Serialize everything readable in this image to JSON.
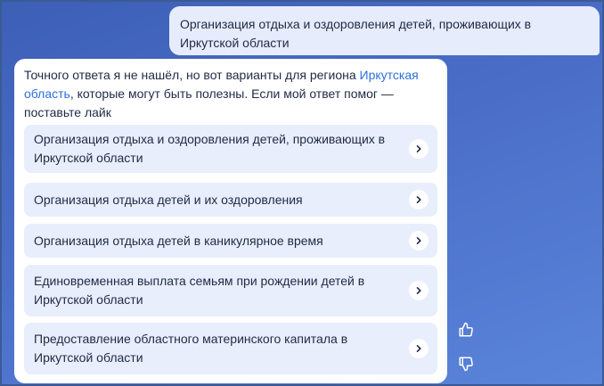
{
  "user_message": "Организация отдыха и оздоровления детей, проживающих в Иркутской области",
  "bot": {
    "text_before_link": "Точного ответа я не нашёл, но вот варианты для региона ",
    "region_link": "Иркутская область",
    "text_after_link": ", которые могут быть полезны. Если мой ответ помог — поставьте лайк",
    "options": [
      {
        "label": "Организация отдыха и оздоровления детей, проживающих в Иркутской области"
      },
      {
        "label": "Организация отдыха детей и их оздоровления"
      },
      {
        "label": "Организация отдыха детей в каникулярное время"
      },
      {
        "label": "Единовременная выплата семьям при рождении детей в Иркутской области"
      },
      {
        "label": "Предоставление областного материнского капитала в Иркутской области"
      }
    ]
  },
  "icons": {
    "option_chevron": "chevron-right-icon",
    "like": "thumbs-up-icon",
    "dislike": "thumbs-down-icon"
  },
  "colors": {
    "background": "#4a6ec8",
    "user_bubble": "#e6ecfb",
    "option_background": "#e8eefc",
    "link": "#2f6fdc",
    "text": "#1f2a44"
  }
}
